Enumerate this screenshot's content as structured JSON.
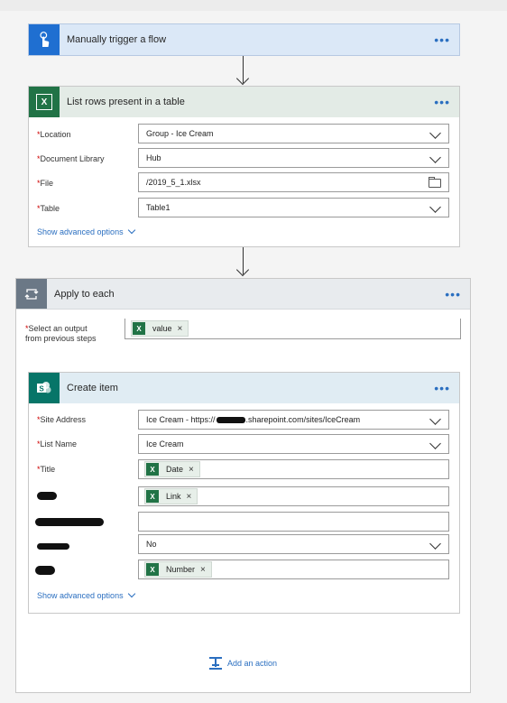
{
  "trigger": {
    "title": "Manually trigger a flow",
    "more": "•••"
  },
  "list_rows": {
    "title": "List rows present in a table",
    "more": "•••",
    "fields": [
      {
        "label": "Location",
        "value": "Group - Ice Cream"
      },
      {
        "label": "Document Library",
        "value": "Hub"
      },
      {
        "label": "File",
        "value": "/2019_5_1.xlsx"
      },
      {
        "label": "Table",
        "value": "Table1"
      }
    ],
    "advanced": "Show advanced options"
  },
  "apply_each": {
    "title": "Apply to each",
    "more": "•••",
    "select_label_1": "Select an output",
    "select_label_2": "from previous steps",
    "token": "value"
  },
  "create_item": {
    "title": "Create item",
    "more": "•••",
    "site_label": "Site Address",
    "site_value_1": "Ice Cream - https://",
    "site_value_2": ".sharepoint.com/sites/IceCream",
    "list_label": "List Name",
    "list_value": "Ice Cream",
    "title_label": "Title",
    "title_token": "Date",
    "link_token": "Link",
    "no_value": "No",
    "number_token": "Number",
    "advanced": "Show advanced options"
  },
  "add_action": "Add an action",
  "excel_letter": "X",
  "required_mark": "*",
  "close_mark": "×",
  "colors": {
    "trigger_header": "#dbe8f7",
    "trigger_icon": "#1f6fd1",
    "excel_green": "#217346",
    "sharepoint_teal": "#077568",
    "header_grey": "#e8ebee",
    "link_blue": "#2b6fc0"
  }
}
